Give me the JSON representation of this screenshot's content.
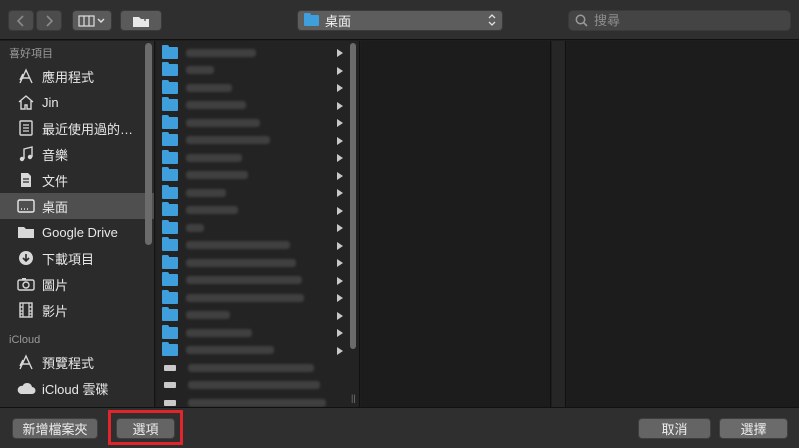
{
  "toolbar": {
    "location": "桌面",
    "search_placeholder": "搜尋"
  },
  "sidebar": {
    "favorites_title": "喜好項目",
    "items": [
      {
        "label": "應用程式",
        "icon": "applications-icon"
      },
      {
        "label": "Jin",
        "icon": "home-icon"
      },
      {
        "label": "最近使用過的…",
        "icon": "recents-icon"
      },
      {
        "label": "音樂",
        "icon": "music-icon"
      },
      {
        "label": "文件",
        "icon": "documents-icon"
      },
      {
        "label": "桌面",
        "icon": "desktop-icon",
        "selected": true
      },
      {
        "label": "Google Drive",
        "icon": "folder-icon"
      },
      {
        "label": "下載項目",
        "icon": "downloads-icon"
      },
      {
        "label": "圖片",
        "icon": "pictures-icon"
      },
      {
        "label": "影片",
        "icon": "movies-icon"
      }
    ],
    "icloud_title": "iCloud",
    "icloud_items": [
      {
        "label": "預覽程式",
        "icon": "preview-icon"
      },
      {
        "label": "iCloud 雲碟",
        "icon": "cloud-icon"
      }
    ]
  },
  "bottom": {
    "new_folder": "新增檔案夾",
    "options": "選項",
    "cancel": "取消",
    "choose": "選擇"
  },
  "colors": {
    "folder": "#3e9fdc",
    "highlight": "#e0262c"
  }
}
